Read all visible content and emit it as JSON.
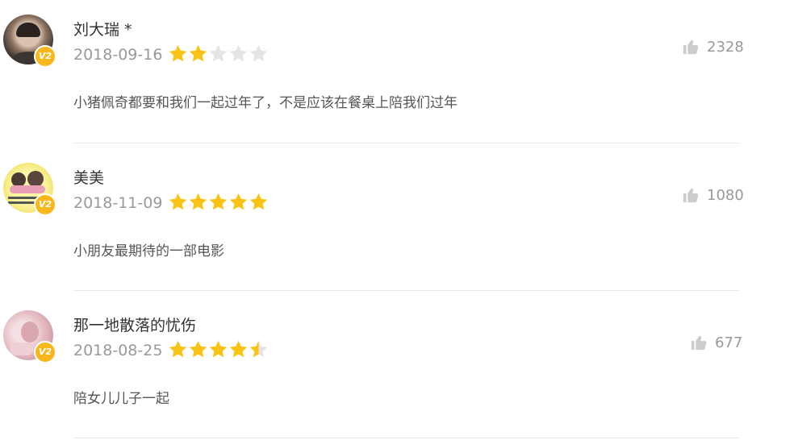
{
  "colors": {
    "star_on": "#f9c316",
    "star_off": "#e5e5e5",
    "badge": "#f8b81b"
  },
  "comments": [
    {
      "username": "刘大瑞 *",
      "level_badge": "V2",
      "date": "2018-09-16",
      "rating": 2,
      "likes": "2328",
      "like_icon": "thumbs-up-icon",
      "text": "小猪佩奇都要和我们一起过年了，不是应该在餐桌上陪我们过年"
    },
    {
      "username": "美美",
      "level_badge": "V2",
      "date": "2018-11-09",
      "rating": 5,
      "likes": "1080",
      "like_icon": "thumbs-up-icon",
      "text": "小朋友最期待的一部电影"
    },
    {
      "username": "那一地散落的忧伤",
      "level_badge": "V2",
      "date": "2018-08-25",
      "rating": 4.5,
      "likes": "677",
      "like_icon": "thumbs-up-icon",
      "text": "陪女儿儿子一起"
    }
  ]
}
